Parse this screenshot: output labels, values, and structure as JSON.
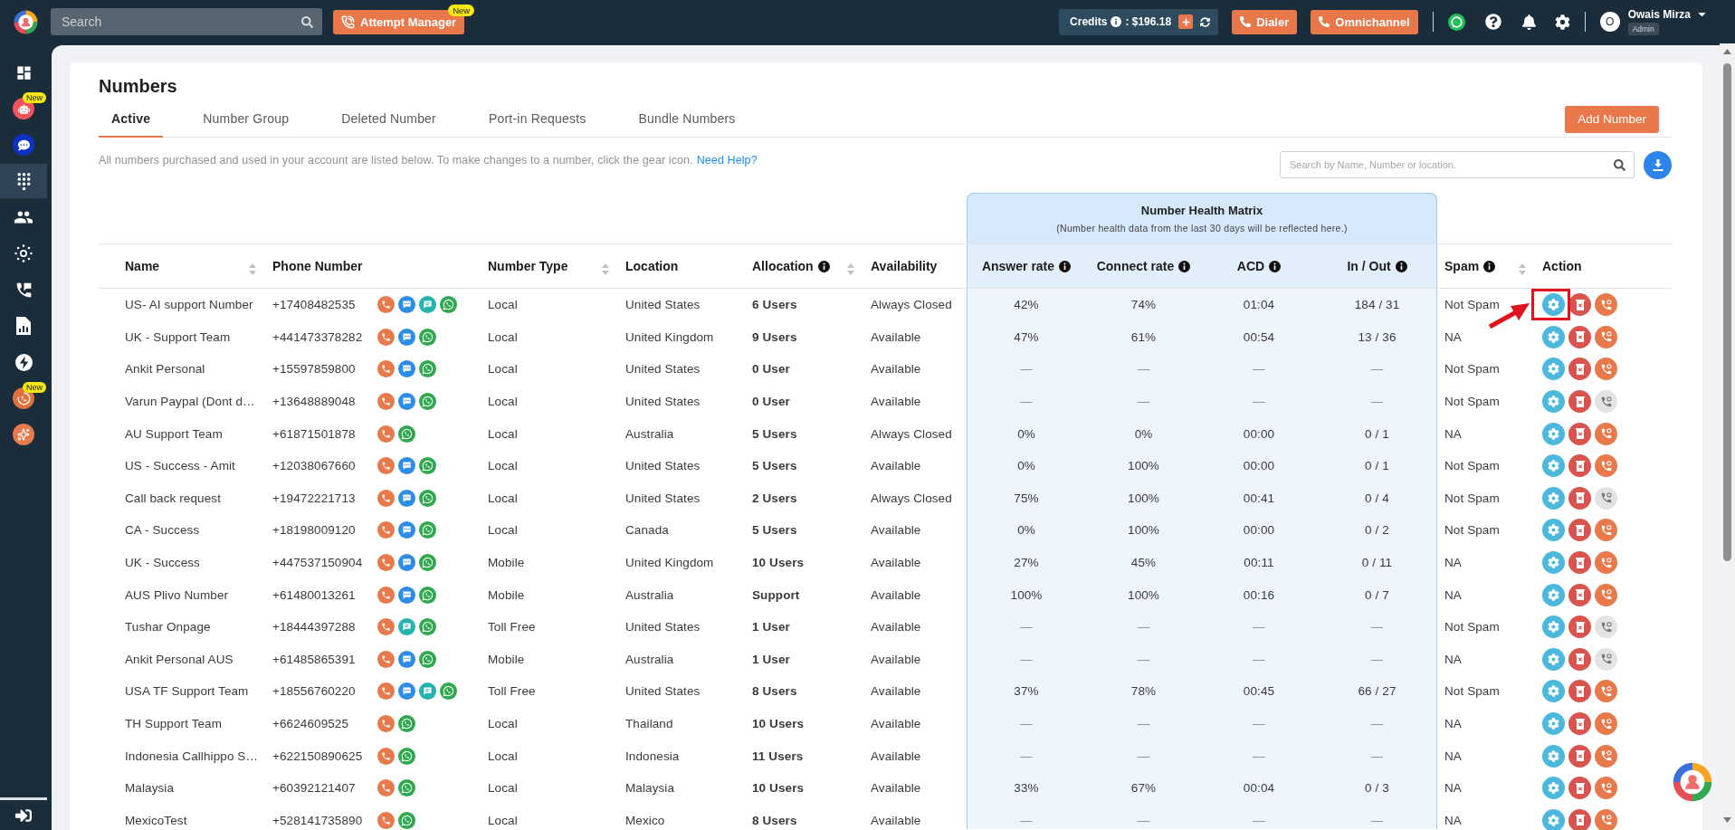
{
  "topbar": {
    "search": {
      "placeholder": "Search"
    },
    "attempt_manager": {
      "label": "Attempt Manager",
      "badge": "New"
    },
    "credits": {
      "label": "Credits",
      "amount": ": $196.18"
    },
    "buttons": [
      {
        "label": "Dialer"
      },
      {
        "label": "Omnichannel"
      }
    ],
    "user": {
      "initial": "O",
      "name": "Owais Mirza",
      "role": "Admin"
    }
  },
  "sidebar": {
    "items": [
      {
        "kind": "dashboard",
        "selected": false
      },
      {
        "kind": "bot",
        "selected": false,
        "badge": "New"
      },
      {
        "kind": "chat",
        "selected": false
      },
      {
        "kind": "numbers",
        "selected": true
      },
      {
        "kind": "contacts",
        "selected": false
      },
      {
        "kind": "integrations",
        "selected": false
      },
      {
        "kind": "call-log",
        "selected": false
      },
      {
        "kind": "reports",
        "selected": false
      },
      {
        "kind": "power",
        "selected": false
      },
      {
        "kind": "attempt",
        "selected": false,
        "badge": "New"
      },
      {
        "kind": "sparkle",
        "selected": false
      }
    ]
  },
  "page": {
    "title": "Numbers",
    "tabs": [
      {
        "label": "Active",
        "selected": true
      },
      {
        "label": "Number Group",
        "selected": false
      },
      {
        "label": "Deleted Number",
        "selected": false
      },
      {
        "label": "Port-in Requests",
        "selected": false
      },
      {
        "label": "Bundle Numbers",
        "selected": false
      }
    ],
    "add_button": "Add Number",
    "description": "All numbers purchased and used in your account are listed below. To make changes to a number, click the gear icon.",
    "help_link": "Need Help?",
    "search": {
      "placeholder": "Search by Name, Number or location."
    }
  },
  "table": {
    "group": {
      "title": "Number Health Matrix",
      "subtitle": "(Number health data from the last 30 days will be reflected here.)"
    },
    "columns": [
      {
        "label": "Name",
        "sortable": true,
        "info": false,
        "kind": "plain"
      },
      {
        "label": "Phone Number",
        "sortable": false,
        "info": false,
        "kind": "plain"
      },
      {
        "label": "Number Type",
        "sortable": true,
        "info": false,
        "kind": "plain"
      },
      {
        "label": "Location",
        "sortable": false,
        "info": false,
        "kind": "plain"
      },
      {
        "label": "Allocation",
        "sortable": true,
        "info": true,
        "kind": "plain"
      },
      {
        "label": "Availability",
        "sortable": false,
        "info": false,
        "kind": "plain"
      },
      {
        "label": "Answer rate",
        "sortable": false,
        "info": true,
        "kind": "health"
      },
      {
        "label": "Connect rate",
        "sortable": false,
        "info": true,
        "kind": "health"
      },
      {
        "label": "ACD",
        "sortable": false,
        "info": true,
        "kind": "health"
      },
      {
        "label": "In / Out",
        "sortable": false,
        "info": true,
        "kind": "health"
      },
      {
        "label": "Spam",
        "sortable": true,
        "info": true,
        "kind": "plain"
      },
      {
        "label": "Action",
        "sortable": false,
        "info": false,
        "kind": "plain"
      }
    ],
    "rows": [
      {
        "name": "US- AI support Number",
        "phone": "+17408482535",
        "channels": [
          {
            "kind": "call"
          },
          {
            "kind": "chat"
          },
          {
            "kind": "sms"
          },
          {
            "kind": "whatsapp"
          }
        ],
        "type": "Local",
        "location": "United States",
        "allocation": "6 Users",
        "availability": "Always Closed",
        "has_health_data": true,
        "health": [
          "42%",
          "74%",
          "01:04",
          "184 / 31"
        ],
        "spam": "Not Spam",
        "call_action_enabled": true,
        "highlighted": true
      },
      {
        "name": "UK - Support Team",
        "phone": "+441473378282",
        "channels": [
          {
            "kind": "call"
          },
          {
            "kind": "chat"
          },
          {
            "kind": "whatsapp"
          }
        ],
        "type": "Local",
        "location": "United Kingdom",
        "allocation": "9 Users",
        "availability": "Available",
        "has_health_data": true,
        "health": [
          "47%",
          "61%",
          "00:54",
          "13 / 36"
        ],
        "spam": "NA",
        "call_action_enabled": true,
        "highlighted": false
      },
      {
        "name": "Ankit Personal",
        "phone": "+15597859800",
        "channels": [
          {
            "kind": "call"
          },
          {
            "kind": "chat"
          },
          {
            "kind": "whatsapp"
          }
        ],
        "type": "Local",
        "location": "United States",
        "allocation": "0 User",
        "availability": "Available",
        "has_health_data": false,
        "health": [
          "—",
          "—",
          "—",
          "—"
        ],
        "spam": "Not Spam",
        "call_action_enabled": true,
        "highlighted": false
      },
      {
        "name": "Varun Paypal (Dont d…",
        "phone": "+13648889048",
        "channels": [
          {
            "kind": "call"
          },
          {
            "kind": "chat"
          },
          {
            "kind": "whatsapp"
          }
        ],
        "type": "Local",
        "location": "United States",
        "allocation": "0 User",
        "availability": "Available",
        "has_health_data": false,
        "health": [
          "—",
          "—",
          "—",
          "—"
        ],
        "spam": "Not Spam",
        "call_action_enabled": false,
        "highlighted": false
      },
      {
        "name": "AU Support Team",
        "phone": "+61871501878",
        "channels": [
          {
            "kind": "call"
          },
          {
            "kind": "whatsapp"
          }
        ],
        "type": "Local",
        "location": "Australia",
        "allocation": "5 Users",
        "availability": "Always Closed",
        "has_health_data": true,
        "health": [
          "0%",
          "0%",
          "00:00",
          "0 / 1"
        ],
        "spam": "NA",
        "call_action_enabled": true,
        "highlighted": false
      },
      {
        "name": "US - Success - Amit",
        "phone": "+12038067660",
        "channels": [
          {
            "kind": "call"
          },
          {
            "kind": "chat"
          },
          {
            "kind": "whatsapp"
          }
        ],
        "type": "Local",
        "location": "United States",
        "allocation": "5 Users",
        "availability": "Available",
        "has_health_data": true,
        "health": [
          "0%",
          "100%",
          "00:00",
          "0 / 1"
        ],
        "spam": "Not Spam",
        "call_action_enabled": true,
        "highlighted": false
      },
      {
        "name": "Call back request",
        "phone": "+19472221713",
        "channels": [
          {
            "kind": "call"
          },
          {
            "kind": "chat"
          },
          {
            "kind": "whatsapp"
          }
        ],
        "type": "Local",
        "location": "United States",
        "allocation": "2 Users",
        "availability": "Always Closed",
        "has_health_data": true,
        "health": [
          "75%",
          "100%",
          "00:41",
          "0 / 4"
        ],
        "spam": "Not Spam",
        "call_action_enabled": false,
        "highlighted": false
      },
      {
        "name": "CA - Success",
        "phone": "+18198009120",
        "channels": [
          {
            "kind": "call"
          },
          {
            "kind": "chat"
          },
          {
            "kind": "whatsapp"
          }
        ],
        "type": "Local",
        "location": "Canada",
        "allocation": "5 Users",
        "availability": "Available",
        "has_health_data": true,
        "health": [
          "0%",
          "100%",
          "00:00",
          "0 / 2"
        ],
        "spam": "Not Spam",
        "call_action_enabled": true,
        "highlighted": false
      },
      {
        "name": "UK - Success",
        "phone": "+447537150904",
        "channels": [
          {
            "kind": "call"
          },
          {
            "kind": "chat"
          },
          {
            "kind": "whatsapp"
          }
        ],
        "type": "Mobile",
        "location": "United Kingdom",
        "allocation": "10 Users",
        "availability": "Available",
        "has_health_data": true,
        "health": [
          "27%",
          "45%",
          "00:11",
          "0 / 11"
        ],
        "spam": "NA",
        "call_action_enabled": true,
        "highlighted": false
      },
      {
        "name": "AUS Plivo Number",
        "phone": "+61480013261",
        "channels": [
          {
            "kind": "call"
          },
          {
            "kind": "chat"
          },
          {
            "kind": "whatsapp"
          }
        ],
        "type": "Mobile",
        "location": "Australia",
        "allocation": "Support",
        "availability": "Available",
        "has_health_data": true,
        "health": [
          "100%",
          "100%",
          "00:16",
          "0 / 7"
        ],
        "spam": "NA",
        "call_action_enabled": true,
        "highlighted": false
      },
      {
        "name": "Tushar Onpage",
        "phone": "+18444397288",
        "channels": [
          {
            "kind": "call"
          },
          {
            "kind": "sms"
          },
          {
            "kind": "whatsapp"
          }
        ],
        "type": "Toll Free",
        "location": "United States",
        "allocation": "1 User",
        "availability": "Available",
        "has_health_data": false,
        "health": [
          "—",
          "—",
          "—",
          "—"
        ],
        "spam": "Not Spam",
        "call_action_enabled": false,
        "highlighted": false
      },
      {
        "name": "Ankit Personal AUS",
        "phone": "+61485865391",
        "channels": [
          {
            "kind": "call"
          },
          {
            "kind": "chat"
          },
          {
            "kind": "whatsapp"
          }
        ],
        "type": "Mobile",
        "location": "Australia",
        "allocation": "1 User",
        "availability": "Available",
        "has_health_data": false,
        "health": [
          "—",
          "—",
          "—",
          "—"
        ],
        "spam": "NA",
        "call_action_enabled": false,
        "highlighted": false
      },
      {
        "name": "USA TF Support Team",
        "phone": "+18556760220",
        "channels": [
          {
            "kind": "call"
          },
          {
            "kind": "chat"
          },
          {
            "kind": "sms"
          },
          {
            "kind": "whatsapp"
          }
        ],
        "type": "Toll Free",
        "location": "United States",
        "allocation": "8 Users",
        "availability": "Available",
        "has_health_data": true,
        "health": [
          "37%",
          "78%",
          "00:45",
          "66 / 27"
        ],
        "spam": "Not Spam",
        "call_action_enabled": true,
        "highlighted": false
      },
      {
        "name": "TH Support Team",
        "phone": "+6624609525",
        "channels": [
          {
            "kind": "call"
          },
          {
            "kind": "whatsapp"
          }
        ],
        "type": "Local",
        "location": "Thailand",
        "allocation": "10 Users",
        "availability": "Available",
        "has_health_data": false,
        "health": [
          "—",
          "—",
          "—",
          "—"
        ],
        "spam": "NA",
        "call_action_enabled": true,
        "highlighted": false
      },
      {
        "name": "Indonesia Callhippo S…",
        "phone": "+622150890625",
        "channels": [
          {
            "kind": "call"
          },
          {
            "kind": "whatsapp"
          }
        ],
        "type": "Local",
        "location": "Indonesia",
        "allocation": "11 Users",
        "availability": "Available",
        "has_health_data": false,
        "health": [
          "—",
          "—",
          "—",
          "—"
        ],
        "spam": "NA",
        "call_action_enabled": true,
        "highlighted": false
      },
      {
        "name": "Malaysia",
        "phone": "+60392121407",
        "channels": [
          {
            "kind": "call"
          },
          {
            "kind": "whatsapp"
          }
        ],
        "type": "Local",
        "location": "Malaysia",
        "allocation": "10 Users",
        "availability": "Available",
        "has_health_data": true,
        "health": [
          "33%",
          "67%",
          "00:04",
          "0 / 3"
        ],
        "spam": "NA",
        "call_action_enabled": true,
        "highlighted": false
      },
      {
        "name": "MexicoTest",
        "phone": "+528141735890",
        "channels": [
          {
            "kind": "call"
          },
          {
            "kind": "whatsapp"
          }
        ],
        "type": "Local",
        "location": "Mexico",
        "allocation": "8 Users",
        "availability": "Available",
        "has_health_data": false,
        "health": [
          "—",
          "—",
          "—",
          "—"
        ],
        "spam": "NA",
        "call_action_enabled": true,
        "highlighted": false
      }
    ]
  }
}
